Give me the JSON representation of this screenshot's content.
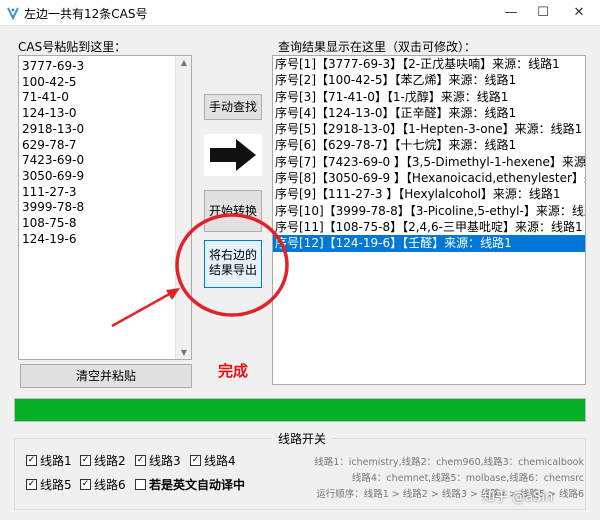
{
  "window": {
    "title": "左边一共有12条CAS号",
    "minimize": "—",
    "maximize": "☐",
    "close": "✕"
  },
  "left_label": "CAS号粘贴到这里：",
  "cas_list": [
    "3777-69-3",
    "100-42-5",
    "71-41-0",
    "124-13-0",
    "2918-13-0",
    "629-78-7",
    "7423-69-0",
    "3050-69-9",
    "111-27-3",
    "3999-78-8",
    "108-75-8",
    "124-19-6"
  ],
  "right_label": "查询结果显示在这里（双击可修改）：",
  "results": [
    "序号[1]【3777-69-3】【2-正戊基呋喃】来源：线路1",
    "序号[2]【100-42-5】【苯乙烯】来源：线路1",
    "序号[3]【71-41-0】【1-戊醇】来源：线路1",
    "序号[4]【124-13-0】【正辛醛】来源：线路1",
    "序号[5]【2918-13-0】【1-Hepten-3-one】来源：线路1",
    "序号[6]【629-78-7】【十七烷】来源：线路1",
    "序号[7]【7423-69-0 】【3,5-Dimethyl-1-hexene】来源：",
    "序号[8]【3050-69-9 】【Hexanoicacid,ethenylester】来",
    "序号[9]【111-27-3 】【Hexylalcohol】来源：线路1",
    "序号[10]【3999-78-8】【3-Picoline,5-ethyl-】来源：线路",
    "序号[11]【108-75-8】【2,4,6-三甲基吡啶】来源：线路1",
    "序号[12]【124-19-6】【壬醛】来源：线路1"
  ],
  "selected_result_index": 11,
  "buttons": {
    "manual_search": "手动查找",
    "start_convert": "开始转换",
    "export_line1": "将右边的",
    "export_line2": "结果导出",
    "clear_paste": "清空并粘贴"
  },
  "status_text": "完成",
  "progress": 1.0,
  "group_title": "线路开关",
  "routes": [
    {
      "label": "线路1",
      "checked": true
    },
    {
      "label": "线路2",
      "checked": true
    },
    {
      "label": "线路3",
      "checked": true
    },
    {
      "label": "线路4",
      "checked": true
    },
    {
      "label": "线路5",
      "checked": true
    },
    {
      "label": "线路6",
      "checked": true
    }
  ],
  "auto_translate": {
    "label": "若是英文自动译中",
    "checked": false
  },
  "route_info": [
    "线路1：ichemistry,线路2：chem960,线路3：chemicalbook",
    "线路4：chemnet,线路5：molbase,线路6：chemsrc",
    "运行顺序：线路1 > 线路2 > 线路3 > 线路4 > 线路5 > 线路6"
  ],
  "watermark": "知乎 @aSin",
  "colors": {
    "accent": "#0078d7",
    "progress": "#06b025",
    "annotation": "#e32228",
    "status": "#e81010"
  }
}
